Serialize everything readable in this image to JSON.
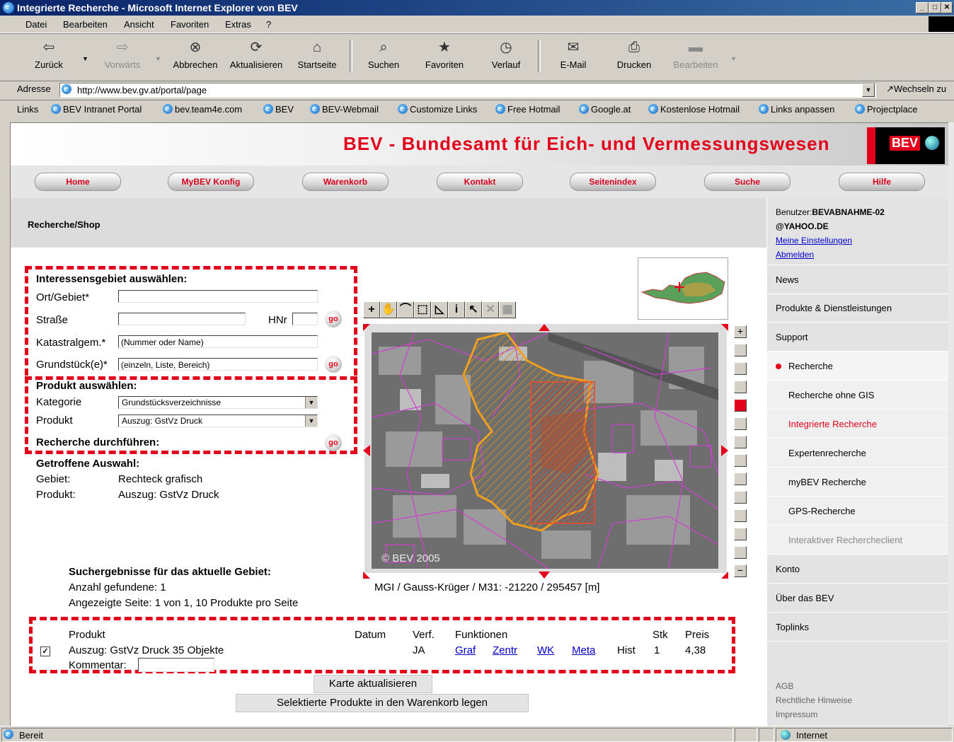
{
  "window": {
    "title": "Integrierte Recherche - Microsoft Internet Explorer von BEV"
  },
  "menu": [
    "Datei",
    "Bearbeiten",
    "Ansicht",
    "Favoriten",
    "Extras",
    "?"
  ],
  "toolbar": {
    "back": "Zurück",
    "forward": "Vorwärts",
    "stop": "Abbrechen",
    "refresh": "Aktualisieren",
    "home": "Startseite",
    "search": "Suchen",
    "favorites": "Favoriten",
    "history": "Verlauf",
    "mail": "E-Mail",
    "print": "Drucken",
    "edit": "Bearbeiten"
  },
  "address": {
    "label": "Adresse",
    "url": "http://www.bev.gv.at/portal/page",
    "go": "Wechseln zu"
  },
  "links": {
    "label": "Links",
    "items": [
      "BEV Intranet Portal",
      "bev.team4e.com",
      "BEV",
      "BEV-Webmail",
      "Customize Links",
      "Free Hotmail",
      "Google.at",
      "Kostenlose Hotmail",
      "Links anpassen",
      "Projectplace"
    ]
  },
  "site": {
    "banner": "BEV - Bundesamt für Eich- und Vermessungswesen",
    "logo_text": "BEV",
    "nav": [
      "Home",
      "MyBEV Konfig",
      "Warenkorb",
      "Kontakt",
      "Seitenindex",
      "Suche",
      "Hilfe"
    ],
    "section_title": "Recherche/Shop"
  },
  "user": {
    "label": "Benutzer:",
    "name1": "BEVABNAHME-02",
    "name2": "@YAHOO.DE",
    "settings": "Meine Einstellungen",
    "logout": "Abmelden"
  },
  "sidebar": {
    "items": [
      "News",
      "Produkte & Dienstleistungen",
      "Support",
      "Recherche",
      "Recherche ohne GIS",
      "Integrierte Recherche",
      "Expertenrecherche",
      "myBEV Recherche",
      "GPS-Recherche",
      "Interaktiver Rechercheclient",
      "Konto",
      "Über das BEV",
      "Toplinks"
    ],
    "footer": [
      "AGB",
      "Rechtliche Hinweise",
      "Impressum"
    ]
  },
  "form": {
    "area_title": "Interessensgebiet auswählen:",
    "ort_label": "Ort/Gebiet*",
    "ort_value": "",
    "strasse_label": "Straße",
    "strasse_value": "",
    "hnr_label": "HNr",
    "hnr_value": "",
    "kg_label": "Katastralgem.*",
    "kg_value": "(Nummer oder Name)",
    "gst_label": "Grundstück(e)*",
    "gst_value": "(einzeln, Liste, Bereich)",
    "go": "go",
    "product_title": "Produkt auswählen:",
    "kategorie_label": "Kategorie",
    "kategorie_value": "Grundstücksverzeichnisse",
    "produkt_label": "Produkt",
    "produkt_value": "Auszug: GstVz Druck",
    "execute_title": "Recherche durchführen:"
  },
  "selection": {
    "title": "Getroffene Auswahl:",
    "gebiet_label": "Gebiet:",
    "gebiet_value": "Rechteck grafisch",
    "produkt_label": "Produkt:",
    "produkt_value": "Auszug: GstVz Druck"
  },
  "map": {
    "copyright": "© BEV 2005",
    "coords": "MGI / Gauss-Krüger / M31: -21220 / 295457 [m]",
    "tools": [
      "+",
      "✋",
      "⌒",
      "⬚",
      "◺",
      "i",
      "↖",
      "✕",
      "▦"
    ]
  },
  "results": {
    "title": "Suchergebnisse für das aktuelle Gebiet:",
    "count": "Anzahl gefundene: 1",
    "page": "Angezeigte Seite: 1 von 1, 10 Produkte pro Seite",
    "headers": {
      "produkt": "Produkt",
      "datum": "Datum",
      "verf": "Verf.",
      "funktionen": "Funktionen",
      "stk": "Stk",
      "preis": "Preis"
    },
    "row": {
      "checked": true,
      "produkt": "Auszug: GstVz Druck 35 Objekte",
      "verf": "JA",
      "links": [
        "Graf",
        "Zentr",
        "WK",
        "Meta"
      ],
      "hist": "Hist",
      "stk": "1",
      "preis": "4,38",
      "kommentar_label": "Kommentar:",
      "kommentar_value": ""
    },
    "btn_update": "Karte aktualisieren",
    "btn_cart": "Selektierte Produkte in den Warenkorb legen"
  },
  "status": {
    "text": "Bereit",
    "zone": "Internet"
  },
  "colors": {
    "accent": "#e3001b",
    "titlebar": "#0a246a",
    "link": "#0000cc"
  }
}
